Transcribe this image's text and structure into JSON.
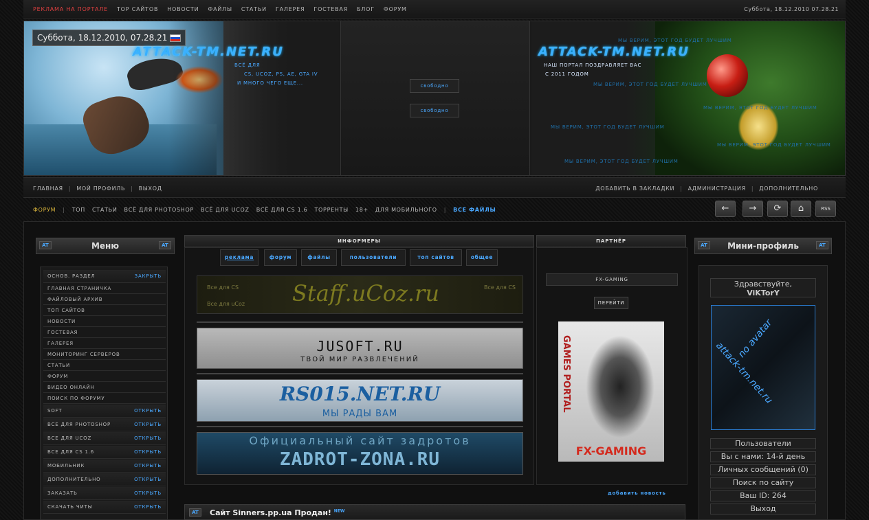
{
  "topbar": {
    "items": [
      "Реклама на портале",
      "ТОР САЙТОВ",
      "НОВОСТИ",
      "ФАЙЛЫ",
      "СТАТЬИ",
      "ГАЛЕРЕЯ",
      "ГОСТЕВАЯ",
      "БЛОГ",
      "ФОРУМ"
    ],
    "date": "Суббота, 18.12.2010 07.28.21"
  },
  "header": {
    "date_badge": "Суббота, 18.12.2010, 07.28.21",
    "logo_left": "ATTACK-TM.NET.RU",
    "tagline_lines": [
      "ВСЁ ДЛЯ",
      "CS, UCOZ, PS, AE, GTA IV",
      "И МНОГО ЧЕГО ЕЩЕ..."
    ],
    "free_label_1": "свободно",
    "free_label_2": "свободно",
    "logo_right": "ATTACK-TM.NET.RU",
    "congrats_lines": [
      "НАШ ПОРТАЛ ПОЗДРАВЛЯЕТ ВАС",
      "С 2011 ГОДОМ"
    ],
    "faint_text": "МЫ ВЕРИМ, ЭТОТ ГОД БУДЕТ ЛУЧШИМ"
  },
  "nav1": {
    "left": [
      "ГЛАВНАЯ",
      "МОЙ ПРОФИЛЬ",
      "ВЫХОД"
    ],
    "right": [
      "ДОБАВИТЬ В ЗАКЛАДКИ",
      "АДМИНИСТРАЦИЯ",
      "ДОПОЛНИТЕЛЬНО"
    ]
  },
  "nav2": {
    "items": [
      "ФОРУМ",
      "ТОП",
      "СТАТЬИ",
      "ВСЁ ДЛЯ PHOTOSHOP",
      "ВСЁ ДЛЯ UCOZ",
      "ВСЁ ДЛЯ CS 1.6",
      "ТОРРЕНТЫ",
      "18+",
      "ДЛЯ МОБИЛЬНОГО",
      "ВСЕ ФАЙЛЫ"
    ],
    "tools": [
      "←",
      "→",
      "⟳",
      "⌂",
      "RSS"
    ]
  },
  "menu": {
    "title": "Меню",
    "badge": "AT",
    "section": {
      "label": "ОСНОВ. РАЗДЕЛ",
      "action": "ЗАКРЫТЬ"
    },
    "items": [
      "ГЛАВНАЯ СТРАНИЧКА",
      "ФАЙЛОВЫЙ АРХИВ",
      "ТОП САЙТОВ",
      "НОВОСТИ",
      "ГОСТЕВАЯ",
      "ГАЛЕРЕЯ",
      "МОНИТОРИНГ СЕРВЕРОВ",
      "СТАТЬИ",
      "ФОРУМ",
      "ВИДЕО ОНЛАЙН",
      "ПОИСК ПО ФОРУМУ"
    ],
    "groups": [
      {
        "label": "SOFT",
        "action": "ОТКРЫТЬ"
      },
      {
        "label": "ВСЕ ДЛЯ PHOTOSHOP",
        "action": "ОТКРЫТЬ"
      },
      {
        "label": "ВСЕ ДЛЯ UCOZ",
        "action": "ОТКРЫТЬ"
      },
      {
        "label": "ВСЕ ДЛЯ CS 1.6",
        "action": "ОТКРЫТЬ"
      },
      {
        "label": "МОБИЛЬНИК",
        "action": "ОТКРЫТЬ"
      },
      {
        "label": "ДОПОЛНИТЕЛЬНО",
        "action": "ОТКРЫТЬ"
      },
      {
        "label": "ЗАКАЗАТЬ",
        "action": "ОТКРЫТЬ"
      },
      {
        "label": "СКАЧАТЬ ЧИТЫ",
        "action": "ОТКРЫТЬ"
      }
    ]
  },
  "informers": {
    "title": "ИНФОРМЕРЫ",
    "tabs": [
      "реклама",
      "форум",
      "файлы",
      "пользователи",
      "топ сайтов",
      "общее"
    ],
    "banners": [
      {
        "text": "Staff.uCoz.ru",
        "small_1": "Все для CS",
        "small_2": "Все для uCoz",
        "small_3": "Все для CS"
      },
      {
        "text": "JUSOFT.RU",
        "sub": "ТВОЙ МИР РАЗВЛЕЧЕНИЙ"
      },
      {
        "text": "RS015.NET.RU",
        "sub": "МЫ РАДЫ ВАМ"
      },
      {
        "text": "ZADROT-ZONA.RU",
        "sub": "Официальный сайт задротов"
      }
    ]
  },
  "partner": {
    "title": "ПАРТНЁР",
    "name": "FX-GAMING",
    "go": "ПЕРЕЙТИ",
    "img_text": "FX-GAMING",
    "img_side": "GAMES PORTAL"
  },
  "mini": {
    "title": "Мини-профиль",
    "badge": "AT",
    "greeting": "Здравствуйте,",
    "user": "ViKTorY",
    "avatar_1": "no avatar",
    "avatar_2": "attack-tm.net.ru",
    "rows": [
      "Пользователи",
      "Вы с нами: 14-й день",
      "Личных сообщений (0)",
      "Поиск по сайту",
      "Ваш ID: 264",
      "Выход"
    ]
  },
  "news": {
    "add": "добавить новость",
    "badge": "AT",
    "title": "Сайт Sinners.pp.ua Продан!",
    "new": "NEW"
  }
}
